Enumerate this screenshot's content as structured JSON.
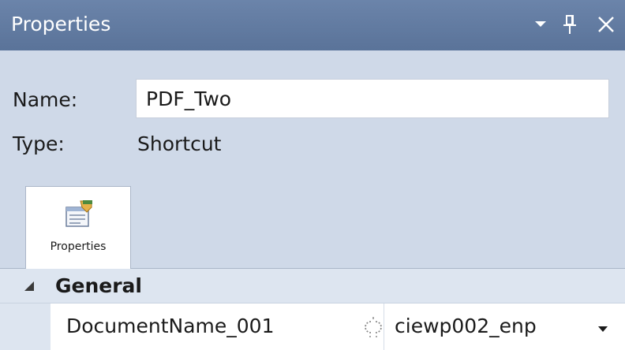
{
  "window": {
    "title": "Properties",
    "buttons": {
      "dropdown_icon": "chevron-down-icon",
      "pin_icon": "pin-icon",
      "close_icon": "close-icon"
    }
  },
  "header": {
    "name_label": "Name:",
    "name_value": "PDF_Two",
    "type_label": "Type:",
    "type_value": "Shortcut"
  },
  "tabs": [
    {
      "label": "Properties",
      "icon": "properties-icon",
      "active": true
    }
  ],
  "grid": {
    "category": {
      "label": "General",
      "expanded": true
    },
    "rows": [
      {
        "name": "DocumentName_001",
        "value": "ciewp002_enp",
        "link_icon": "link-icon"
      }
    ]
  },
  "colors": {
    "titlebar": "#5f789e",
    "header_bg": "#cfd9e8",
    "category_bg": "#dde5f0"
  }
}
